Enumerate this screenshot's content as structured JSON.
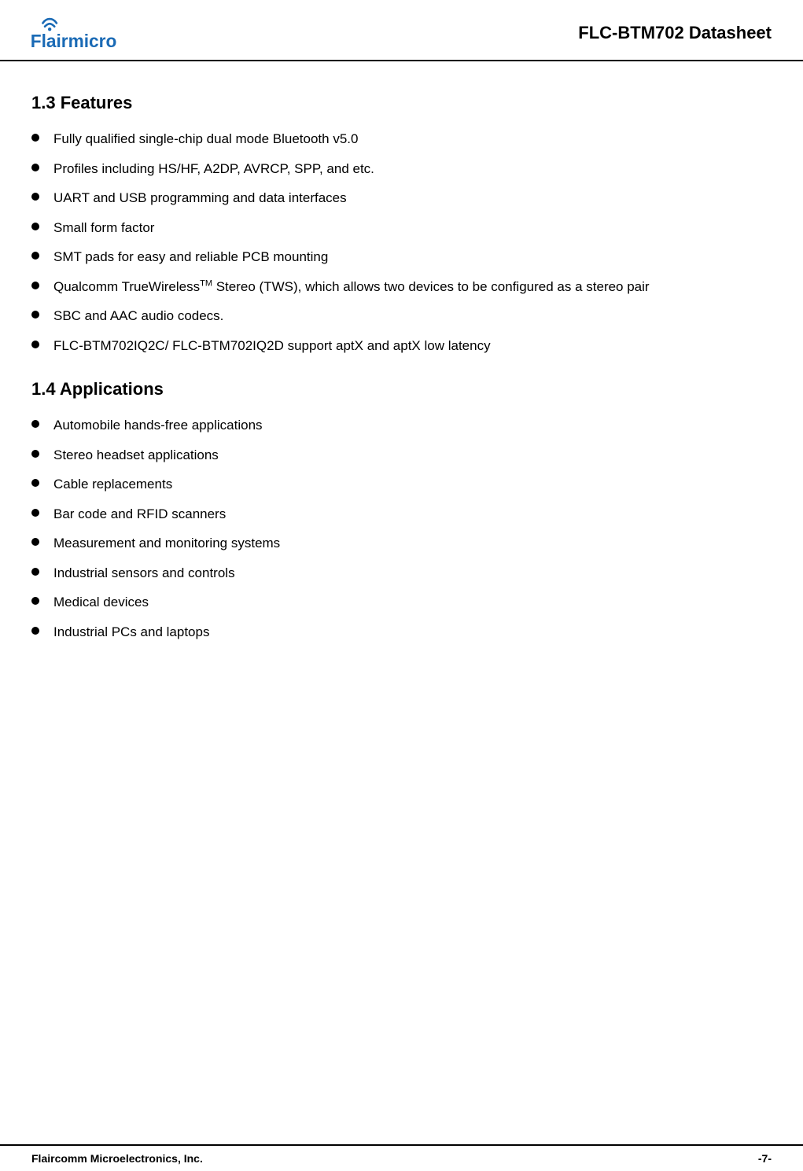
{
  "header": {
    "title": "FLC-BTM702 Datasheet",
    "logo_text_flairm": "Flairm",
    "logo_text_icro": "icro"
  },
  "sections": [
    {
      "id": "features",
      "heading": "1.3 Features",
      "items": [
        {
          "text": "Fully qualified single-chip dual mode Bluetooth v5.0",
          "has_sup": false,
          "sup_text": ""
        },
        {
          "text": "Profiles including HS/HF, A2DP, AVRCP, SPP, and etc.",
          "has_sup": false,
          "sup_text": ""
        },
        {
          "text": "UART and USB programming and data interfaces",
          "has_sup": false,
          "sup_text": ""
        },
        {
          "text": "Small form factor",
          "has_sup": false,
          "sup_text": ""
        },
        {
          "text": "SMT pads for easy and reliable PCB mounting",
          "has_sup": false,
          "sup_text": ""
        },
        {
          "text_before_sup": "Qualcomm TrueWireless",
          "sup_text": "TM",
          "text_after_sup": " Stereo (TWS), which allows two devices to be configured as a stereo pair",
          "has_sup": true
        },
        {
          "text": "SBC and AAC audio codecs.",
          "has_sup": false,
          "sup_text": ""
        },
        {
          "text": "FLC-BTM702IQ2C/ FLC-BTM702IQ2D support aptX and aptX low latency",
          "has_sup": false,
          "sup_text": ""
        }
      ]
    },
    {
      "id": "applications",
      "heading": "1.4 Applications",
      "items": [
        {
          "text": "Automobile hands-free applications",
          "has_sup": false,
          "sup_text": ""
        },
        {
          "text": "Stereo headset applications",
          "has_sup": false,
          "sup_text": ""
        },
        {
          "text": "Cable replacements",
          "has_sup": false,
          "sup_text": ""
        },
        {
          "text": "Bar code and RFID scanners",
          "has_sup": false,
          "sup_text": ""
        },
        {
          "text": "Measurement and monitoring systems",
          "has_sup": false,
          "sup_text": ""
        },
        {
          "text": "Industrial sensors and controls",
          "has_sup": false,
          "sup_text": ""
        },
        {
          "text": "Medical devices",
          "has_sup": false,
          "sup_text": ""
        },
        {
          "text": "Industrial PCs and laptops",
          "has_sup": false,
          "sup_text": ""
        }
      ]
    }
  ],
  "footer": {
    "company": "Flaircomm Microelectronics, Inc.",
    "page": "-7-"
  }
}
